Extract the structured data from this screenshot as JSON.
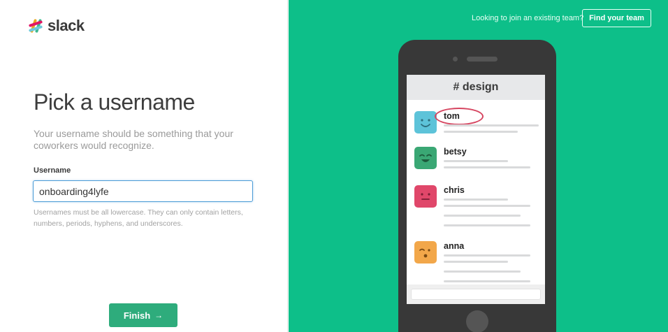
{
  "brand": {
    "name": "slack"
  },
  "form": {
    "title": "Pick a username",
    "subtitle": "Your username should be something that your coworkers would recognize.",
    "username_label": "Username",
    "username_value": "onboarding4lyfe",
    "hint": "Usernames must be all lowercase. They can only contain letters, numbers, periods, hyphens, and underscores.",
    "finish_label": "Finish",
    "finish_arrow": "→"
  },
  "header": {
    "join_text": "Looking to join an existing team?",
    "find_team_label": "Find your team"
  },
  "preview": {
    "channel": "# design",
    "members": [
      {
        "name": "tom",
        "color": "#5dc3d9",
        "icon": "happy-face-icon"
      },
      {
        "name": "betsy",
        "color": "#3aa774",
        "icon": "grin-face-icon"
      },
      {
        "name": "chris",
        "color": "#e0476a",
        "icon": "neutral-face-icon"
      },
      {
        "name": "anna",
        "color": "#f2a74a",
        "icon": "surprised-face-icon"
      }
    ]
  },
  "colors": {
    "accent_green": "#0dbf89",
    "button_green": "#2eac7c",
    "input_focus": "#4a9bd6",
    "highlight_ring": "#d64560"
  }
}
